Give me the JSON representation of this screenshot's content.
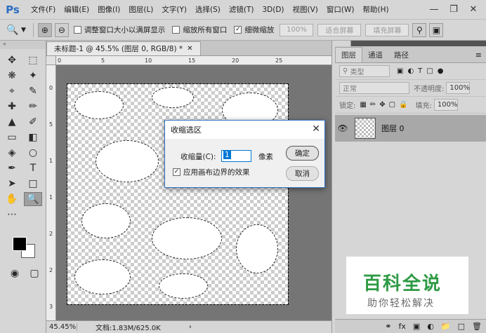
{
  "app": {
    "logo": "Ps"
  },
  "menu": [
    "文件(F)",
    "编辑(E)",
    "图像(I)",
    "图层(L)",
    "文字(Y)",
    "选择(S)",
    "滤镜(T)",
    "3D(D)",
    "视图(V)",
    "窗口(W)",
    "帮助(H)"
  ],
  "options": {
    "resize_windows": "调整窗口大小以满屏显示",
    "zoom_all": "缩放所有窗口",
    "scrubby_zoom": "细微缩放",
    "zoom_value": "100%",
    "fit_screen": "适合屏幕",
    "fill_screen": "填充屏幕"
  },
  "document": {
    "tab_title": "未标题-1 @ 45.5% (图层 0, RGB/8) *",
    "zoom_status": "45.45%",
    "doc_status": "文档:1.83M/625.0K",
    "ruler_h": [
      "0",
      "5",
      "10",
      "15",
      "20",
      "25"
    ],
    "ruler_v": [
      "0",
      "5",
      "1",
      "1",
      "2",
      "2",
      "3"
    ]
  },
  "dialog": {
    "title": "收缩选区",
    "label": "收缩量(C):",
    "value": "1",
    "unit": "像素",
    "checkbox_label": "应用画布边界的效果",
    "checkbox_checked": true,
    "ok_label": "确定",
    "cancel_label": "取消"
  },
  "layers_panel": {
    "tabs": [
      "图层",
      "通道",
      "路径"
    ],
    "filter_kind": "类型",
    "blend_mode": "正常",
    "opacity_label": "不透明度:",
    "opacity_value": "100%",
    "lock_label": "锁定:",
    "fill_label": "填充:",
    "fill_value": "100%",
    "layer_name": "图层 0"
  },
  "watermark": {
    "main": "百科全说",
    "sub": "助你轻松解决"
  },
  "colors": {
    "accent": "#2f72c2",
    "watermark_green": "#2e9a44"
  }
}
